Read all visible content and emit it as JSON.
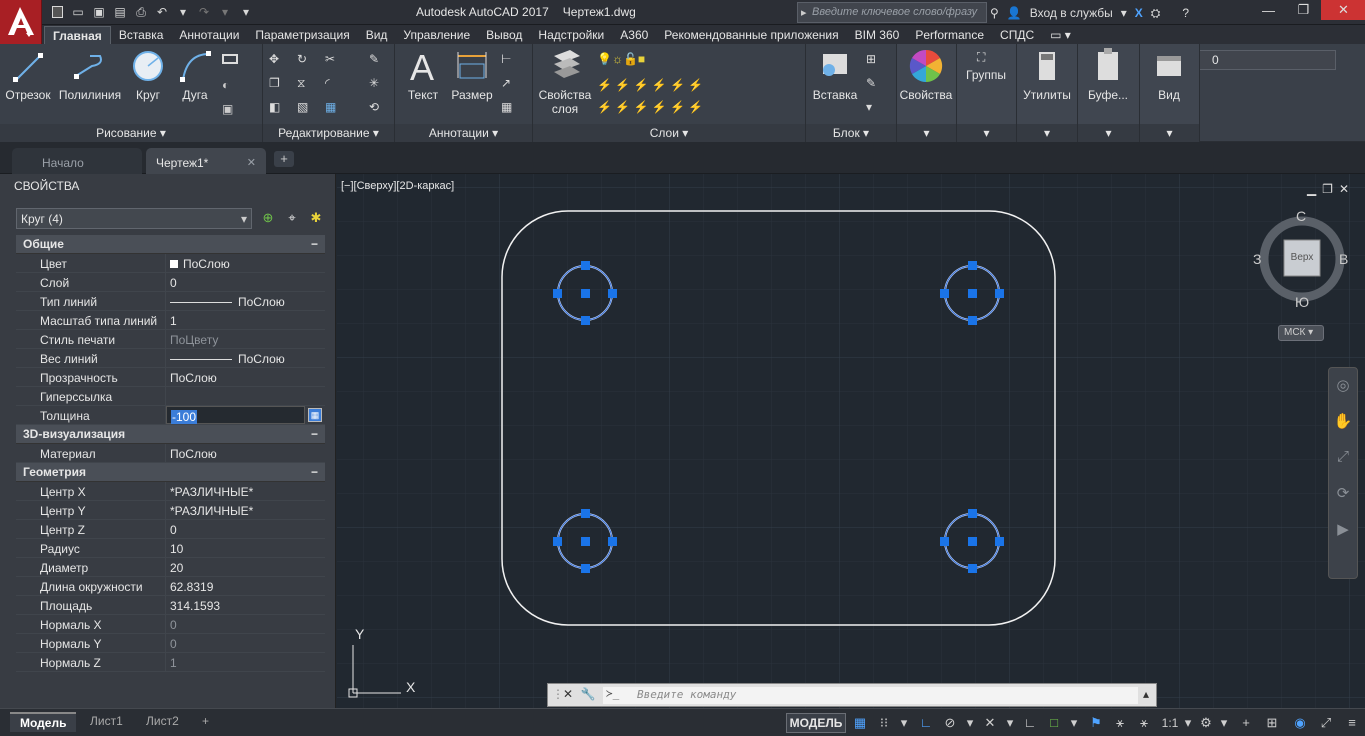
{
  "app": {
    "name": "Autodesk AutoCAD 2017",
    "document": "Чертеж1.dwg",
    "search_placeholder": "Введите ключевое слово/фразу",
    "signin": "Вход в службы"
  },
  "ribbon_tabs": [
    "Главная",
    "Вставка",
    "Аннотации",
    "Параметризация",
    "Вид",
    "Управление",
    "Вывод",
    "Надстройки",
    "A360",
    "Рекомендованные приложения",
    "BIM 360",
    "Performance",
    "СПДС"
  ],
  "ribbon": {
    "draw": {
      "line": "Отрезок",
      "polyline": "Полилиния",
      "circle": "Круг",
      "arc": "Дуга",
      "footer": "Рисование ▾"
    },
    "modify": {
      "footer": "Редактирование ▾"
    },
    "annotation": {
      "text": "Текст",
      "dimension": "Размер",
      "footer": "Аннотации ▾"
    },
    "layers": {
      "layer_props": "Свойства слоя",
      "current_layer": "0",
      "footer": "Слои ▾"
    },
    "block": {
      "insert": "Вставка",
      "footer": "Блок ▾"
    },
    "properties": {
      "label": "Свойства"
    },
    "groups": {
      "label": "Группы"
    },
    "utilities": {
      "label": "Утилиты"
    },
    "clipboard": {
      "label": "Буфе..."
    },
    "view": {
      "label": "Вид"
    }
  },
  "doc_tabs": {
    "start": "Начало",
    "drawing": "Чертеж1*"
  },
  "properties_panel": {
    "title": "СВОЙСТВА",
    "selection": "Круг (4)",
    "cat_general": "Общие",
    "general": [
      {
        "k": "Цвет",
        "v": "ПоСлою"
      },
      {
        "k": "Слой",
        "v": "0"
      },
      {
        "k": "Тип линий",
        "v": "ПоСлою"
      },
      {
        "k": "Масштаб типа линий",
        "v": "1"
      },
      {
        "k": "Стиль печати",
        "v": "ПоЦвету"
      },
      {
        "k": "Вес линий",
        "v": "ПоСлою"
      },
      {
        "k": "Прозрачность",
        "v": "ПоСлою"
      },
      {
        "k": "Гиперссылка",
        "v": ""
      },
      {
        "k": "Толщина",
        "v": "-100"
      }
    ],
    "cat_3d": "3D-визуализация",
    "viz": [
      {
        "k": "Материал",
        "v": "ПоСлою"
      }
    ],
    "cat_geom": "Геометрия",
    "geometry": [
      {
        "k": "Центр X",
        "v": "*РАЗЛИЧНЫЕ*"
      },
      {
        "k": "Центр Y",
        "v": "*РАЗЛИЧНЫЕ*"
      },
      {
        "k": "Центр Z",
        "v": "0"
      },
      {
        "k": "Радиус",
        "v": "10"
      },
      {
        "k": "Диаметр",
        "v": "20"
      },
      {
        "k": "Длина окружности",
        "v": "62.8319"
      },
      {
        "k": "Площадь",
        "v": "314.1593"
      },
      {
        "k": "Нормаль X",
        "v": "0"
      },
      {
        "k": "Нормаль Y",
        "v": "0"
      },
      {
        "k": "Нормаль Z",
        "v": "1"
      }
    ]
  },
  "viewport": {
    "label": "[−][Сверху][2D-каркас]",
    "viewcube": {
      "top": "Верх",
      "n": "С",
      "s": "Ю",
      "w": "З",
      "e": "В"
    },
    "ucs_menu": "МСК",
    "axis_x": "X",
    "axis_y": "Y"
  },
  "command": {
    "placeholder": "Введите команду"
  },
  "layout_tabs": [
    "Модель",
    "Лист1",
    "Лист2"
  ],
  "status": {
    "model": "МОДЕЛЬ",
    "scale": "1:1"
  }
}
